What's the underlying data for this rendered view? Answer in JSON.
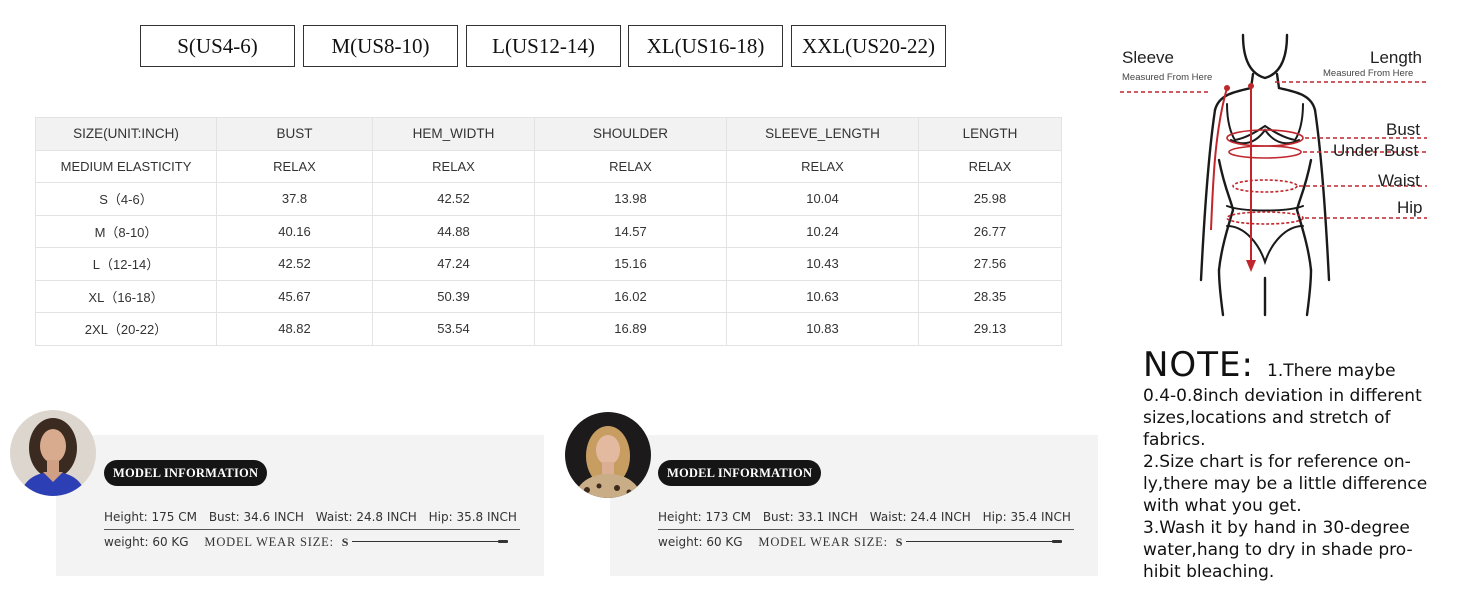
{
  "size_tabs": [
    "S(US4-6)",
    "M(US8-10)",
    "L(US12-14)",
    "XL(US16-18)",
    "XXL(US20-22)"
  ],
  "table": {
    "header1": [
      "SIZE(UNIT:INCH)",
      "BUST",
      "HEM_WIDTH",
      "SHOULDER",
      "SLEEVE_LENGTH",
      "LENGTH"
    ],
    "header2": [
      "MEDIUM ELASTICITY",
      "RELAX",
      "RELAX",
      "RELAX",
      "RELAX",
      "RELAX"
    ],
    "rows": [
      [
        "S（4-6）",
        "37.8",
        "42.52",
        "13.98",
        "10.04",
        "25.98"
      ],
      [
        "M（8-10）",
        "40.16",
        "44.88",
        "14.57",
        "10.24",
        "26.77"
      ],
      [
        "L（12-14）",
        "42.52",
        "47.24",
        "15.16",
        "10.43",
        "27.56"
      ],
      [
        "XL（16-18）",
        "45.67",
        "50.39",
        "16.02",
        "10.63",
        "28.35"
      ],
      [
        "2XL（20-22）",
        "48.82",
        "53.54",
        "16.89",
        "10.83",
        "29.13"
      ]
    ]
  },
  "diagram": {
    "sleeve": "Sleeve",
    "sleeve_sub": "Measured From Here",
    "length": "Length",
    "length_sub": "Measured From Here",
    "bust": "Bust",
    "under_bust": "Under Bust",
    "waist": "Waist",
    "hip": "Hip",
    "accent_color": "#c0272d"
  },
  "note": {
    "title": "NOTE:",
    "first": "1.There maybe",
    "lines": [
      "0.4-0.8inch deviation in different",
      "sizes,locations and stretch of",
      "fabrics.",
      "2.Size chart is for reference on-",
      "ly,there may be a little difference",
      "with what you get.",
      "3.Wash it by hand in 30-degree",
      "water,hang to dry in shade pro-",
      "hibit bleaching."
    ]
  },
  "models": [
    {
      "badge": "MODEL INFORMATION",
      "height": "Height:  175 CM",
      "bust": "Bust:  34.6 INCH",
      "waist": "Waist:  24.8 INCH",
      "hip": "Hip:  35.8 INCH",
      "weight": "weight:  60 KG",
      "wear_label": "MODEL WEAR SIZE:",
      "wear_size": "S"
    },
    {
      "badge": "MODEL INFORMATION",
      "height": "Height:  173 CM",
      "bust": "Bust:  33.1 INCH",
      "waist": "Waist:  24.4 INCH",
      "hip": "Hip:  35.4 INCH",
      "weight": "weight:  60 KG",
      "wear_label": "MODEL WEAR SIZE:",
      "wear_size": "S"
    }
  ]
}
